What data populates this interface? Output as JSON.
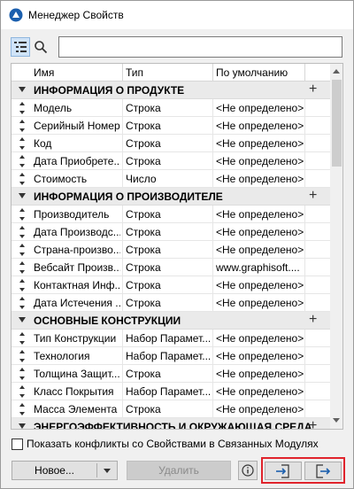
{
  "window": {
    "title": "Менеджер Свойств"
  },
  "toolbar": {
    "search_value": "",
    "search_placeholder": ""
  },
  "table": {
    "columns": [
      "Имя",
      "Тип",
      "По умолчанию"
    ],
    "groups": [
      {
        "name": "ИНФОРМАЦИЯ О ПРОДУКТЕ",
        "rows": [
          {
            "name": "Модель",
            "type": "Строка",
            "default": "<Не определено>"
          },
          {
            "name": "Серийный Номер",
            "type": "Строка",
            "default": "<Не определено>"
          },
          {
            "name": "Код",
            "type": "Строка",
            "default": "<Не определено>"
          },
          {
            "name": "Дата Приобрете...",
            "type": "Строка",
            "default": "<Не определено>"
          },
          {
            "name": "Стоимость",
            "type": "Число",
            "default": "<Не определено>"
          }
        ]
      },
      {
        "name": "ИНФОРМАЦИЯ О ПРОИЗВОДИТЕЛЕ",
        "rows": [
          {
            "name": "Производитель",
            "type": "Строка",
            "default": "<Не определено>"
          },
          {
            "name": "Дата Производс...",
            "type": "Строка",
            "default": "<Не определено>"
          },
          {
            "name": "Страна-произво...",
            "type": "Строка",
            "default": "<Не определено>"
          },
          {
            "name": "Вебсайт Произв...",
            "type": "Строка",
            "default": "www.graphisoft...."
          },
          {
            "name": "Контактная Инф...",
            "type": "Строка",
            "default": "<Не определено>"
          },
          {
            "name": "Дата Истечения ...",
            "type": "Строка",
            "default": "<Не определено>"
          }
        ]
      },
      {
        "name": "ОСНОВНЫЕ КОНСТРУКЦИИ",
        "rows": [
          {
            "name": "Тип Конструкции",
            "type": "Набор Парамет...",
            "default": "<Не определено>"
          },
          {
            "name": "Технология",
            "type": "Набор Парамет...",
            "default": "<Не определено>"
          },
          {
            "name": "Толщина Защит...",
            "type": "Строка",
            "default": "<Не определено>"
          },
          {
            "name": "Класс Покрытия",
            "type": "Набор Парамет...",
            "default": "<Не определено>"
          },
          {
            "name": "Масса Элемента",
            "type": "Строка",
            "default": "<Не определено>"
          }
        ]
      },
      {
        "name": "ЭНЕРГОЭФФЕКТИВНОСТЬ И ОКРУЖАЮЩАЯ СРЕДА",
        "rows": []
      }
    ]
  },
  "footer": {
    "checkbox_label": "Показать конфликты со Свойствами в Связанных Модулях",
    "checkbox_checked": false,
    "new_label": "Новое...",
    "delete_label": "Удалить"
  },
  "colors": {
    "highlight": "#e0242c",
    "active_tool": "#cfe3f8",
    "group_bg": "#eaeaea"
  },
  "icons": [
    "app-icon",
    "list-view-icon",
    "search-icon",
    "plus-icon",
    "drag-handle-icon",
    "info-icon",
    "import-icon",
    "export-icon"
  ]
}
